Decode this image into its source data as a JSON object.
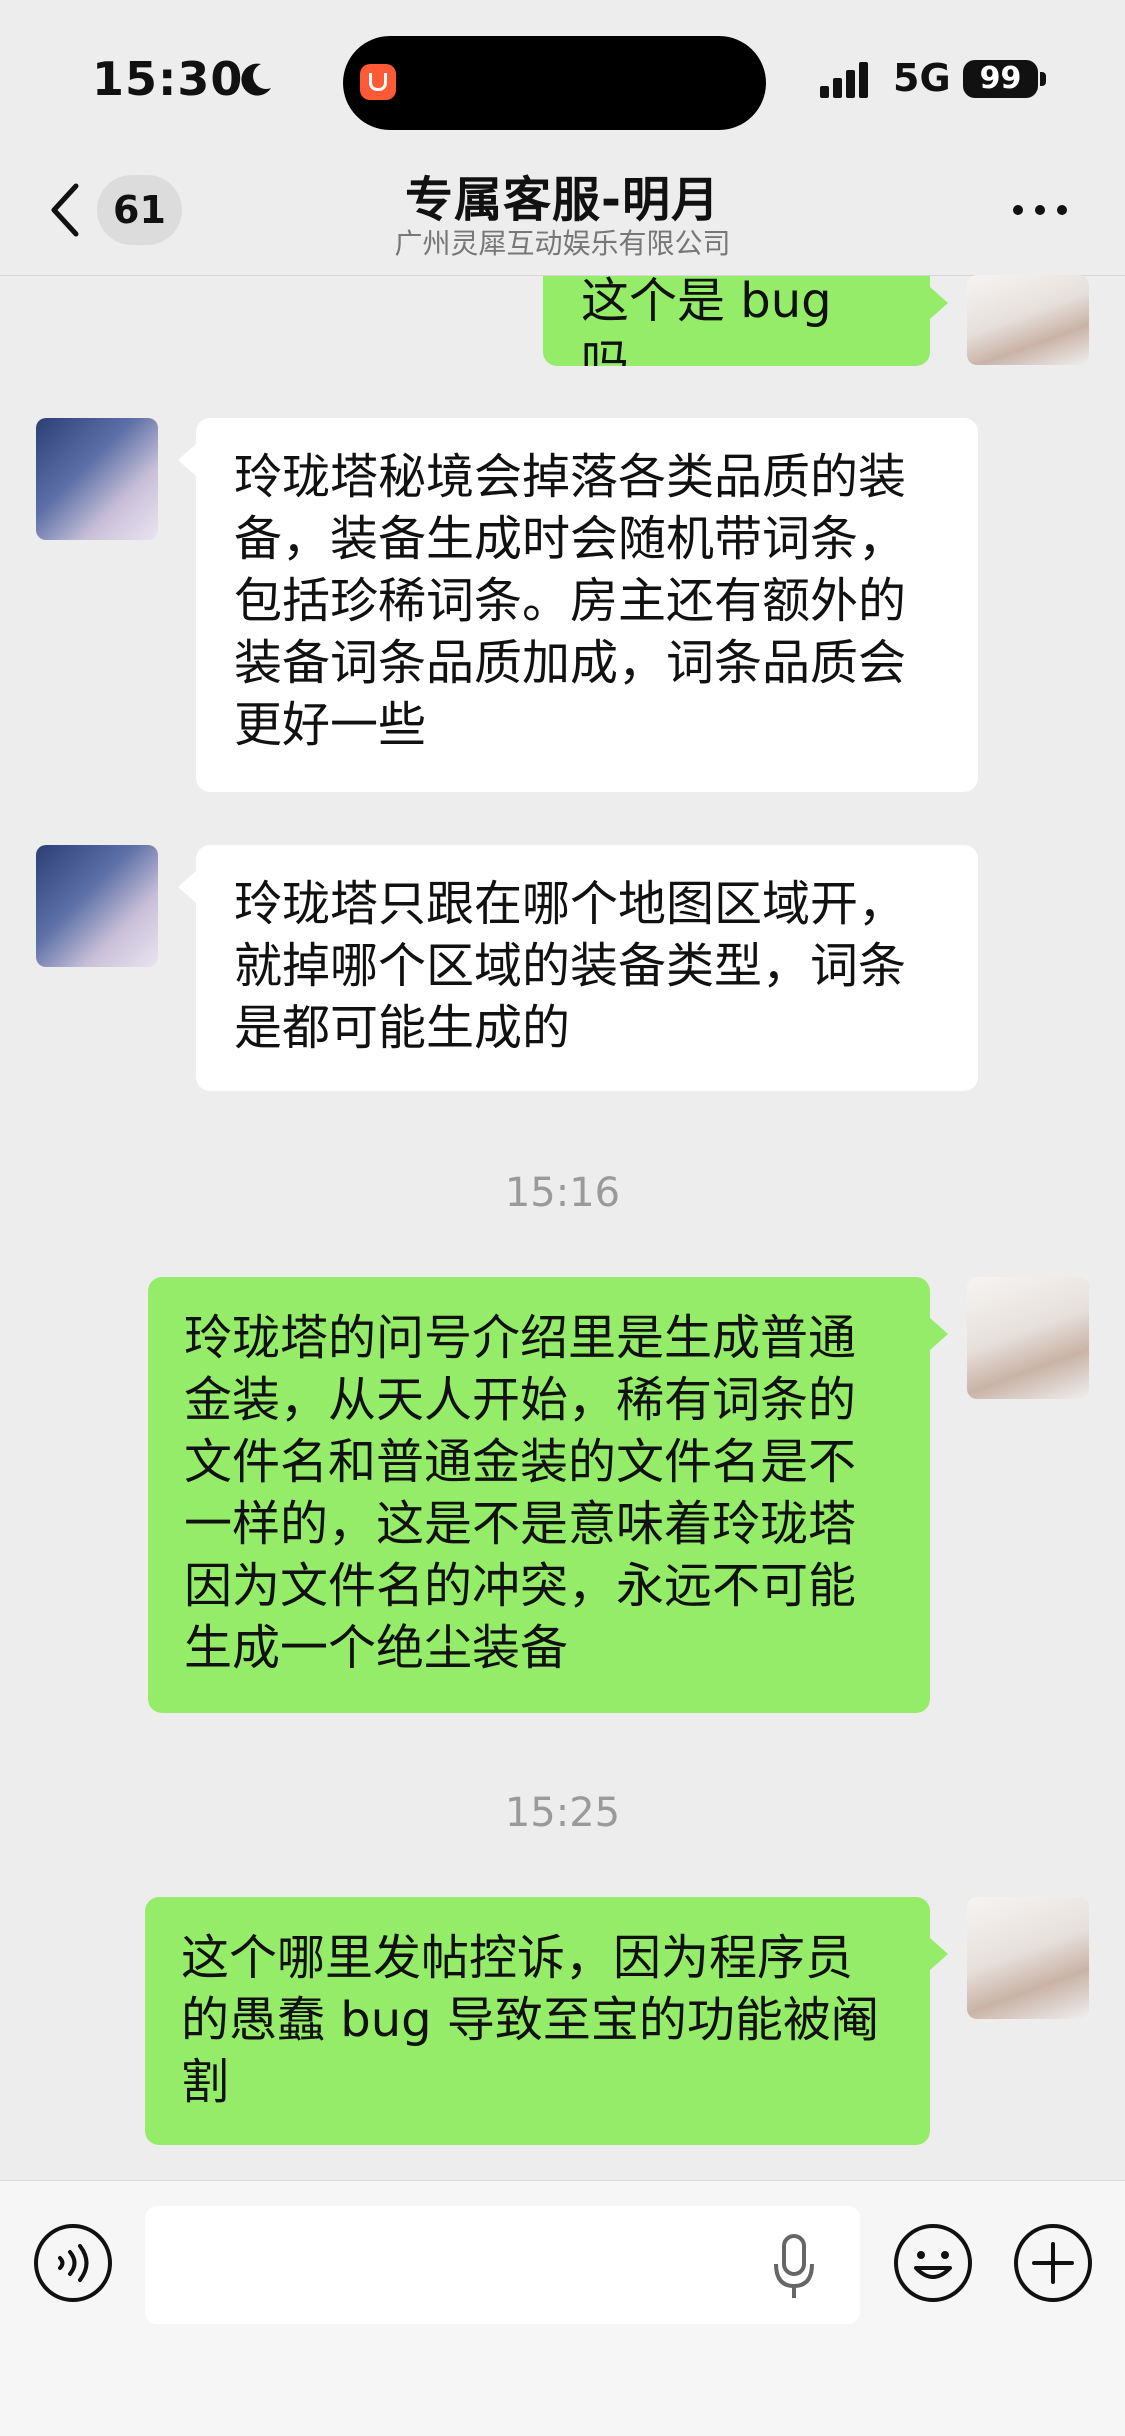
{
  "status_bar": {
    "time": "15:30",
    "network": "5G",
    "battery": "99",
    "icons": [
      "moon-icon",
      "app-indicator-icon",
      "signal-icon"
    ]
  },
  "header": {
    "unread_count": "61",
    "title": "专属客服-明月",
    "subtitle": "广州灵犀互动娱乐有限公司",
    "icons": [
      "back-arrow-icon",
      "more-icon"
    ]
  },
  "messages": [
    {
      "sender": "user",
      "text": "这个是 bug 吗"
    },
    {
      "sender": "agent",
      "text": "玲珑塔秘境会掉落各类品质的装备，装备生成时会随机带词条，包括珍稀词条。房主还有额外的装备词条品质加成，词条品质会更好一些"
    },
    {
      "sender": "agent",
      "text": "玲珑塔只跟在哪个地图区域开，就掉哪个区域的装备类型，词条是都可能生成的"
    },
    {
      "timestamp": "15:16"
    },
    {
      "sender": "user",
      "text": "玲珑塔的问号介绍里是生成普通金装，从天人开始，稀有词条的文件名和普通金装的文件名是不一样的，这是不是意味着玲珑塔因为文件名的冲突，永远不可能生成一个绝尘装备"
    },
    {
      "timestamp": "15:25"
    },
    {
      "sender": "user",
      "text": "这个哪里发帖控诉，因为程序员的愚蠢 bug 导致至宝的功能被阉割"
    }
  ],
  "input_bar": {
    "placeholder": "",
    "value": "",
    "icons": [
      "voice-icon",
      "mic-icon",
      "emoji-icon",
      "plus-icon"
    ]
  },
  "colors": {
    "background": "#ededed",
    "user_bubble": "#95ec69",
    "agent_bubble": "#ffffff",
    "battery_bg": "#111111"
  }
}
